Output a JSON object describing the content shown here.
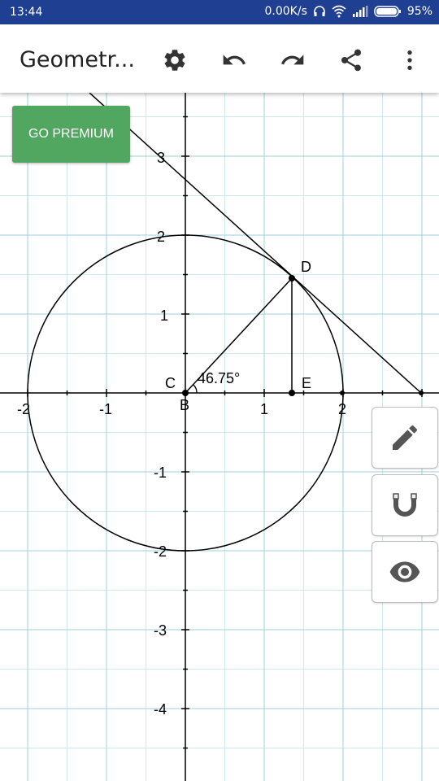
{
  "status_bar": {
    "time": "13:44",
    "net_speed": "0.00K/s",
    "battery": "95%"
  },
  "app_bar": {
    "title": "Geometr..."
  },
  "premium_button": {
    "label": "GO PREMIUM"
  },
  "graph": {
    "x_ticks": [
      "-2",
      "-1",
      "1",
      "2"
    ],
    "y_ticks": [
      "3",
      "2",
      "1",
      "-1",
      "-2",
      "-3",
      "-4"
    ],
    "points": {
      "B": "B",
      "C": "C",
      "D": "D",
      "E": "E"
    },
    "angle_label": "46.75°",
    "circle": {
      "center": [
        0,
        0
      ],
      "radius": 2
    },
    "point_D": [
      1.3714,
      1.4557
    ],
    "point_E": [
      1.3714,
      0
    ]
  },
  "colors": {
    "status_bar": "#1f3f93",
    "premium": "#52a760",
    "grid": "#b7dde8",
    "icon": "#555555"
  }
}
